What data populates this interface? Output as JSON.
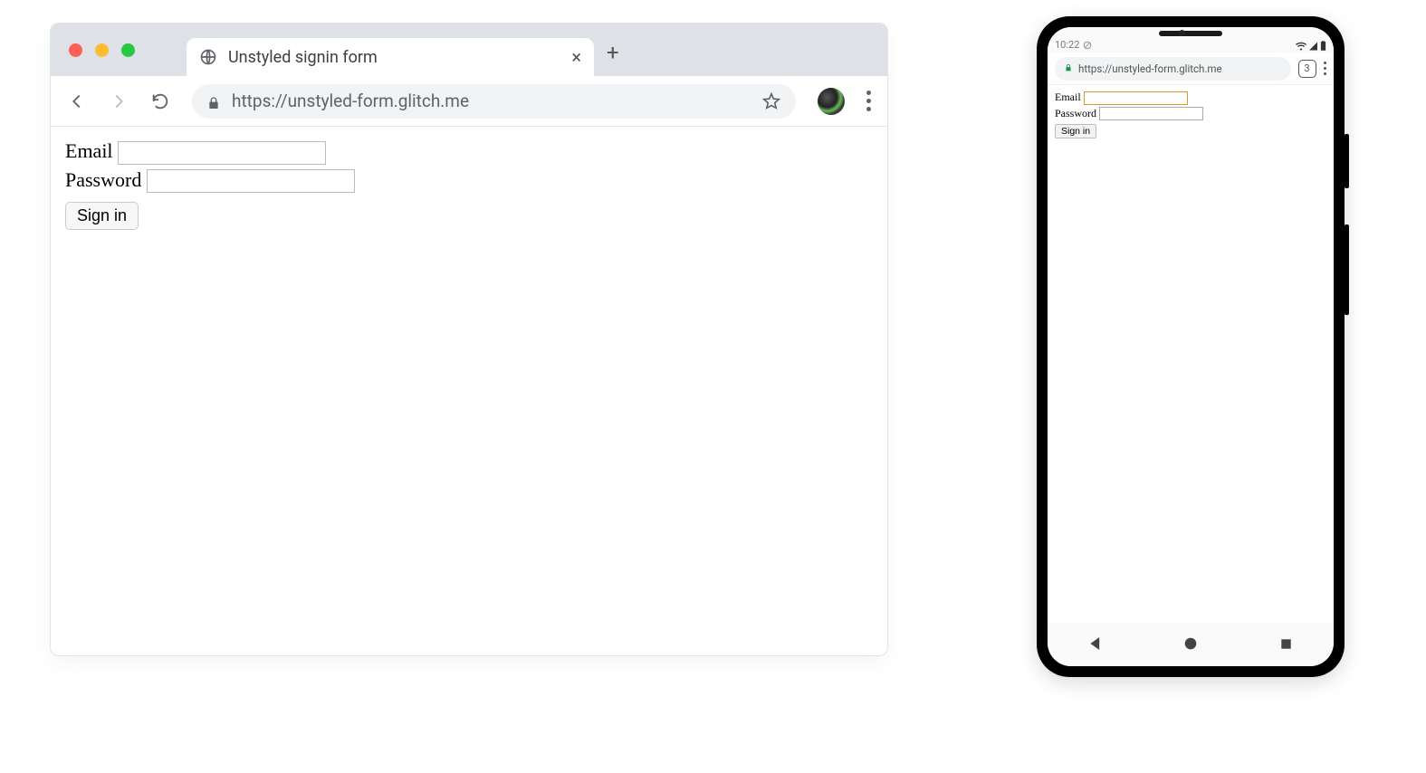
{
  "desktop": {
    "tab_title": "Unstyled signin form",
    "url": "https://unstyled-form.glitch.me",
    "page": {
      "email_label": "Email",
      "password_label": "Password",
      "signin_button": "Sign in"
    }
  },
  "phone": {
    "statusbar_time": "10:22",
    "url": "https://unstyled-form.glitch.me",
    "tab_count": "3",
    "page": {
      "email_label": "Email",
      "password_label": "Password",
      "signin_button": "Sign in"
    }
  }
}
